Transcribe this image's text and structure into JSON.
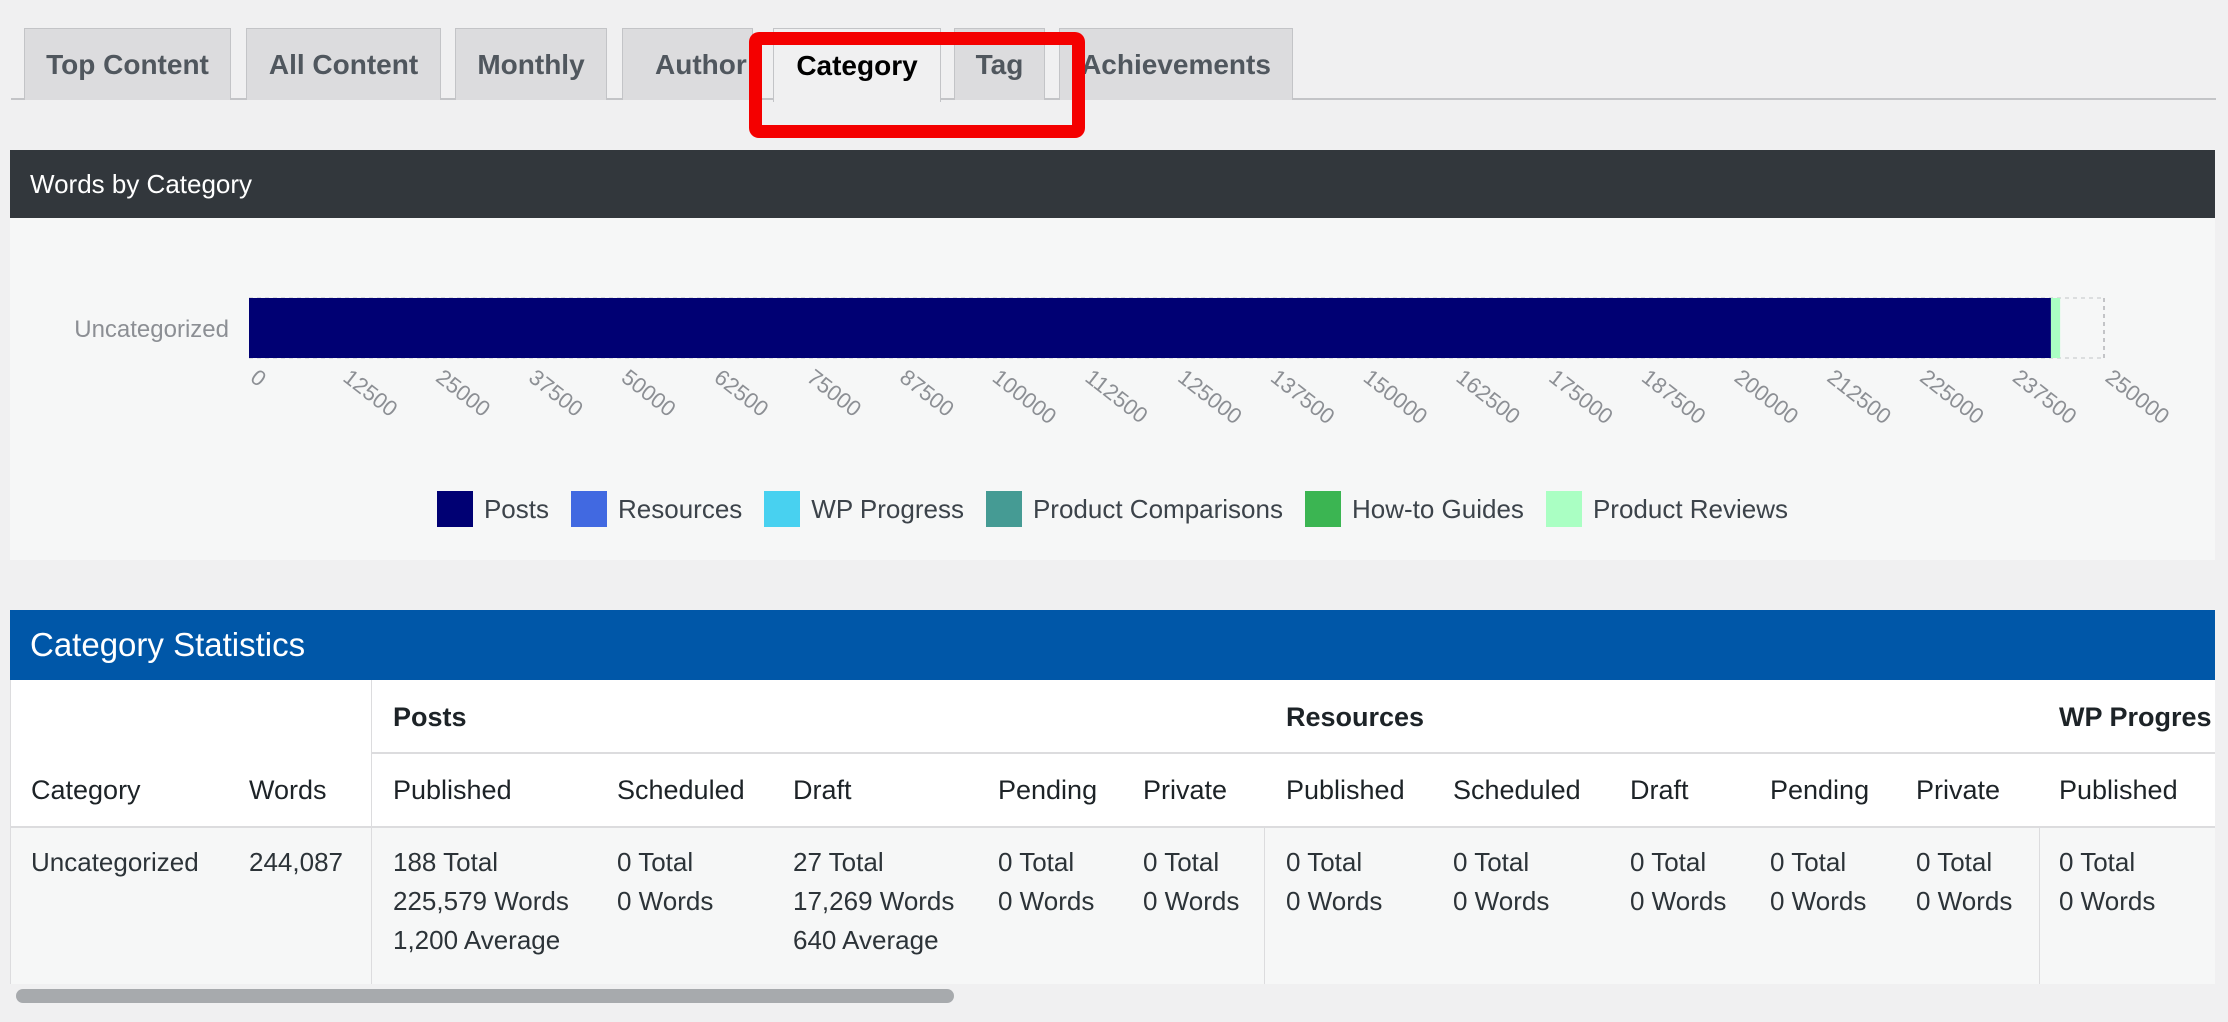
{
  "tabs": [
    {
      "label": "Top Content",
      "active": false
    },
    {
      "label": "All Content",
      "active": false
    },
    {
      "label": "Monthly",
      "active": false
    },
    {
      "label": "Author",
      "active": false
    },
    {
      "label": "Category",
      "active": true
    },
    {
      "label": "Tag",
      "active": false
    },
    {
      "label": "Achievements",
      "active": false
    }
  ],
  "chart_panel": {
    "header": "Words by Category"
  },
  "chart_data": {
    "type": "bar",
    "orientation": "horizontal",
    "stacked": true,
    "categories": [
      "Uncategorized"
    ],
    "series": [
      {
        "name": "Posts",
        "color": "#000073",
        "values": [
          242848
        ]
      },
      {
        "name": "Resources",
        "color": "#4169e1",
        "values": [
          0
        ]
      },
      {
        "name": "WP Progress",
        "color": "#48d1f0",
        "values": [
          0
        ]
      },
      {
        "name": "Product Comparisons",
        "color": "#459b94",
        "values": [
          0
        ]
      },
      {
        "name": "How-to Guides",
        "color": "#3bb552",
        "values": [
          0
        ]
      },
      {
        "name": "Product Reviews",
        "color": "#aaffc3",
        "values": [
          1239
        ]
      }
    ],
    "xticks": [
      "0",
      "12500",
      "25000",
      "37500",
      "50000",
      "62500",
      "75000",
      "87500",
      "100000",
      "112500",
      "125000",
      "137500",
      "150000",
      "162500",
      "175000",
      "187500",
      "200000",
      "212500",
      "225000",
      "237500",
      "250000"
    ],
    "xlim": [
      0,
      250000
    ],
    "legend_position": "bottom"
  },
  "stats": {
    "title": "Category Statistics",
    "group_headers": [
      "Posts",
      "Resources",
      "WP Progres"
    ],
    "columns": [
      "Category",
      "Words",
      "Published",
      "Scheduled",
      "Draft",
      "Pending",
      "Private",
      "Published",
      "Scheduled",
      "Draft",
      "Pending",
      "Private",
      "Published"
    ],
    "row": {
      "category": "Uncategorized",
      "words": "244,087",
      "cells": [
        [
          "188 Total",
          "225,579 Words",
          "1,200 Average"
        ],
        [
          "0 Total",
          "0 Words"
        ],
        [
          "27 Total",
          "17,269 Words",
          "640 Average"
        ],
        [
          "0 Total",
          "0 Words"
        ],
        [
          "0 Total",
          "0 Words"
        ],
        [
          "0 Total",
          "0 Words"
        ],
        [
          "0 Total",
          "0 Words"
        ],
        [
          "0 Total",
          "0 Words"
        ],
        [
          "0 Total",
          "0 Words"
        ],
        [
          "0 Total",
          "0 Words"
        ],
        [
          "0 Total",
          "0 Words"
        ]
      ]
    }
  }
}
